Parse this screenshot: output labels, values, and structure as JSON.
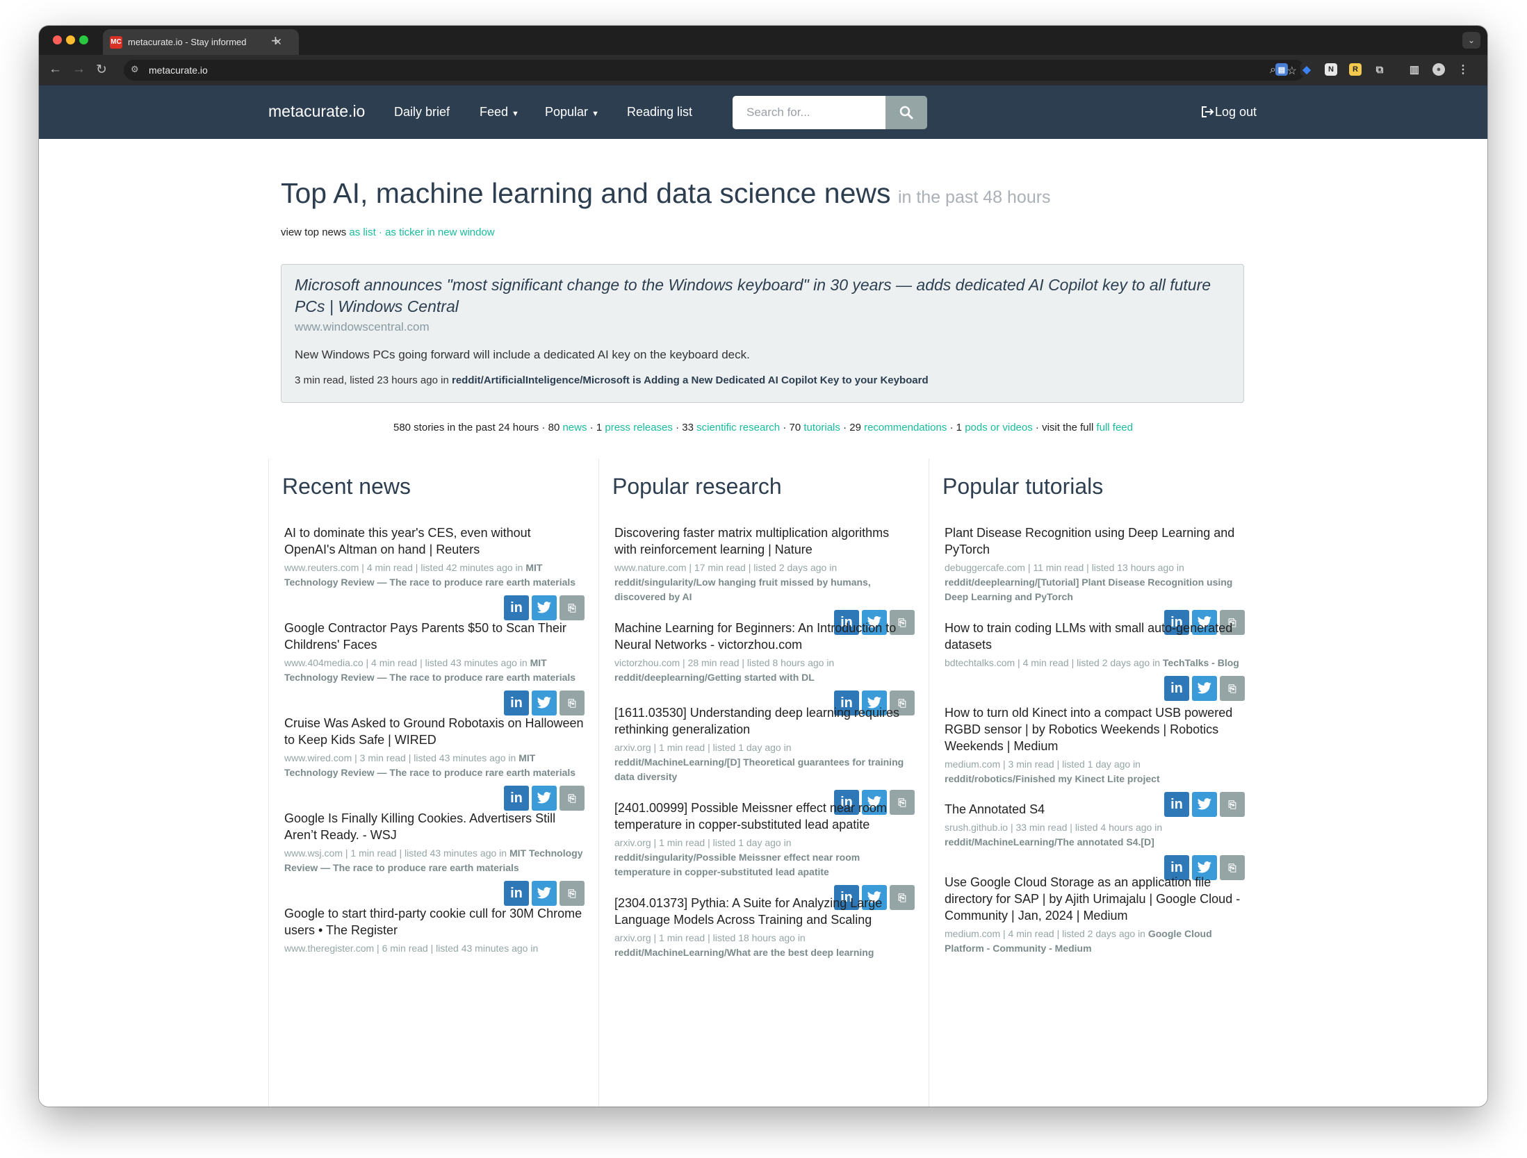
{
  "browser": {
    "tab_title": "metacurate.io - Stay informed",
    "favicon_text": "MC",
    "url": "metacurate.io",
    "new_tab_label": "+"
  },
  "nav": {
    "brand": "metacurate.io",
    "daily_brief": "Daily brief",
    "feed": "Feed",
    "popular": "Popular",
    "reading_list": "Reading list",
    "search_placeholder": "Search for...",
    "logout": "Log out"
  },
  "header": {
    "title": "Top AI, machine learning and data science news",
    "subtitle": "in the past 48 hours",
    "view_prefix": "view top news",
    "as_list": "as list",
    "separator": "·",
    "as_ticker": "as ticker in new window"
  },
  "featured": {
    "title": "Microsoft announces \"most significant change to the Windows keyboard\" in 30 years — adds dedicated AI Copilot key to all future PCs | Windows Central",
    "domain": "www.windowscentral.com",
    "description": "New Windows PCs going forward will include a dedicated AI key on the keyboard deck.",
    "meta_prefix": "3 min read, listed 23 hours ago in",
    "meta_source": "reddit/ArtificialInteligence/Microsoft is Adding a New Dedicated AI Copilot Key to your Keyboard"
  },
  "stats": {
    "stories": "580 stories in the past 24 hours · 80",
    "news": "news",
    "t1": "· 1",
    "press": "press releases",
    "t2": "· 33",
    "research": "scientific research",
    "t3": "· 70",
    "tutorials": "tutorials",
    "t4": "· 29",
    "recommendations": "recommendations",
    "t5": "· 1",
    "pods": "pods or videos",
    "t6": "· visit the full",
    "full_feed": "full feed"
  },
  "columns": [
    {
      "title": "Recent news",
      "articles": [
        {
          "title": "AI to dominate this year's CES, even without OpenAI's Altman on hand | Reuters",
          "meta": "www.reuters.com | 4 min read | listed 42 minutes ago in",
          "source": "MIT Technology Review — The race to produce rare earth materials"
        },
        {
          "title": "Google Contractor Pays Parents $50 to Scan Their Childrens' Faces",
          "meta": "www.404media.co | 4 min read | listed 43 minutes ago in",
          "source": "MIT Technology Review — The race to produce rare earth materials"
        },
        {
          "title": "Cruise Was Asked to Ground Robotaxis on Halloween to Keep Kids Safe | WIRED",
          "meta": "www.wired.com | 3 min read | listed 43 minutes ago in",
          "source": "MIT Technology Review — The race to produce rare earth materials"
        },
        {
          "title": "Google Is Finally Killing Cookies. Advertisers Still Aren’t Ready. - WSJ",
          "meta": "www.wsj.com | 1 min read | listed 43 minutes ago in",
          "source": "MIT Technology Review — The race to produce rare earth materials"
        },
        {
          "title": "Google to start third-party cookie cull for 30M Chrome users • The Register",
          "meta": "www.theregister.com | 6 min read | listed 43 minutes ago in",
          "source": ""
        }
      ]
    },
    {
      "title": "Popular research",
      "articles": [
        {
          "title": "Discovering faster matrix multiplication algorithms with reinforcement learning | Nature",
          "meta": "www.nature.com | 17 min read | listed 2 days ago in",
          "source": "reddit/singularity/Low hanging fruit missed by humans, discovered by AI"
        },
        {
          "title": "Machine Learning for Beginners: An Introduction to Neural Networks - victorzhou.com",
          "meta": "victorzhou.com | 28 min read | listed 8 hours ago in",
          "source": "reddit/deeplearning/Getting started with DL"
        },
        {
          "title": "[1611.03530] Understanding deep learning requires rethinking generalization",
          "meta": "arxiv.org | 1 min read | listed 1 day ago in",
          "source": "reddit/MachineLearning/[D] Theoretical guarantees for training data diversity"
        },
        {
          "title": "[2401.00999] Possible Meissner effect near room temperature in copper-substituted lead apatite",
          "meta": "arxiv.org | 1 min read | listed 1 day ago in",
          "source": "reddit/singularity/Possible Meissner effect near room temperature in copper-substituted lead apatite"
        },
        {
          "title": "[2304.01373] Pythia: A Suite for Analyzing Large Language Models Across Training and Scaling",
          "meta": "arxiv.org | 1 min read | listed 18 hours ago in",
          "source": "reddit/MachineLearning/What are the best deep learning"
        }
      ]
    },
    {
      "title": "Popular tutorials",
      "articles": [
        {
          "title": "Plant Disease Recognition using Deep Learning and PyTorch",
          "meta": "debuggercafe.com | 11 min read | listed 13 hours ago in",
          "source": "reddit/deeplearning/[Tutorial] Plant Disease Recognition using Deep Learning and PyTorch"
        },
        {
          "title": "How to train coding LLMs with small auto-generated datasets",
          "meta": "bdtechtalks.com | 4 min read | listed 2 days ago in",
          "source": "TechTalks - Blog"
        },
        {
          "title": "How to turn old Kinect into a compact USB powered RGBD sensor | by Robotics Weekends | Robotics Weekends | Medium",
          "meta": "medium.com | 3 min read | listed 1 day ago in",
          "source": "reddit/robotics/Finished my Kinect Lite project"
        },
        {
          "title": "The Annotated S4",
          "meta": "srush.github.io | 33 min read | listed 4 hours ago in",
          "source": "reddit/MachineLearning/The annotated S4.[D]"
        },
        {
          "title": "Use Google Cloud Storage as an application file directory for SAP | by Ajith Urimajalu | Google Cloud - Community | Jan, 2024 | Medium",
          "meta": "medium.com | 4 min read | listed 2 days ago in",
          "source": "Google Cloud Platform - Community - Medium"
        }
      ]
    }
  ],
  "share": {
    "linkedin": "in",
    "twitter": "twitter-icon",
    "other": "bookmark-icon"
  }
}
